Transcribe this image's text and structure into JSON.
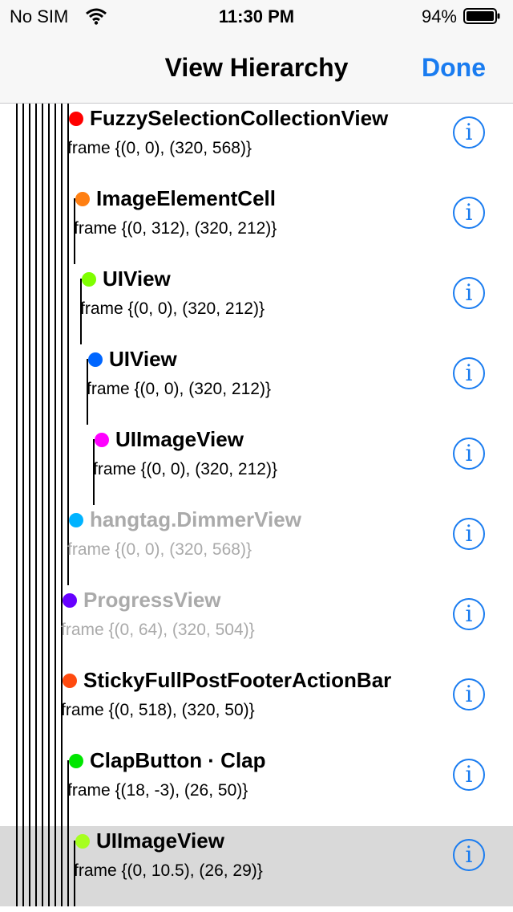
{
  "status_bar": {
    "carrier": "No SIM",
    "time": "11:30 PM",
    "battery": "94%"
  },
  "nav": {
    "title": "View Hierarchy",
    "done": "Done"
  },
  "colors": {
    "accent": "#1a7cf0",
    "dimmed_text": "#aaaaaa",
    "selected_row": "#d9d9d9"
  },
  "rows": [
    {
      "name": "FuzzySelectionCollectionView",
      "frame": "frame {(0, 0), (320, 568)}",
      "dot": "#ff0000",
      "dimmed": false,
      "selected": false
    },
    {
      "name": "ImageElementCell",
      "frame": "frame {(0, 312), (320, 212)}",
      "dot": "#ff7f12",
      "dimmed": false,
      "selected": false
    },
    {
      "name": "UIView",
      "frame": "frame {(0, 0), (320, 212)}",
      "dot": "#7fff00",
      "dimmed": false,
      "selected": false
    },
    {
      "name": "UIView",
      "frame": "frame {(0, 0), (320, 212)}",
      "dot": "#0066ff",
      "dimmed": false,
      "selected": false
    },
    {
      "name": "UIImageView",
      "frame": "frame {(0, 0), (320, 212)}",
      "dot": "#ff00ff",
      "dimmed": false,
      "selected": false
    },
    {
      "name": "hangtag.DimmerView",
      "frame": "frame {(0, 0), (320, 568)}",
      "dot": "#00b3ff",
      "dimmed": true,
      "selected": false
    },
    {
      "name": "ProgressView",
      "frame": "frame {(0, 64), (320, 504)}",
      "dot": "#6600ff",
      "dimmed": true,
      "selected": false
    },
    {
      "name": "StickyFullPostFooterActionBar",
      "frame": "frame {(0, 518), (320, 50)}",
      "dot": "#ff4a0f",
      "dimmed": false,
      "selected": false
    },
    {
      "name": "ClapButton · Clap",
      "frame": "frame {(18, -3), (26, 50)}",
      "dot": "#00e600",
      "dimmed": false,
      "selected": false
    },
    {
      "name": "UIImageView",
      "frame": "frame {(0, 10.5), (26, 29)}",
      "dot": "#a6ff1f",
      "dimmed": false,
      "selected": true
    }
  ]
}
